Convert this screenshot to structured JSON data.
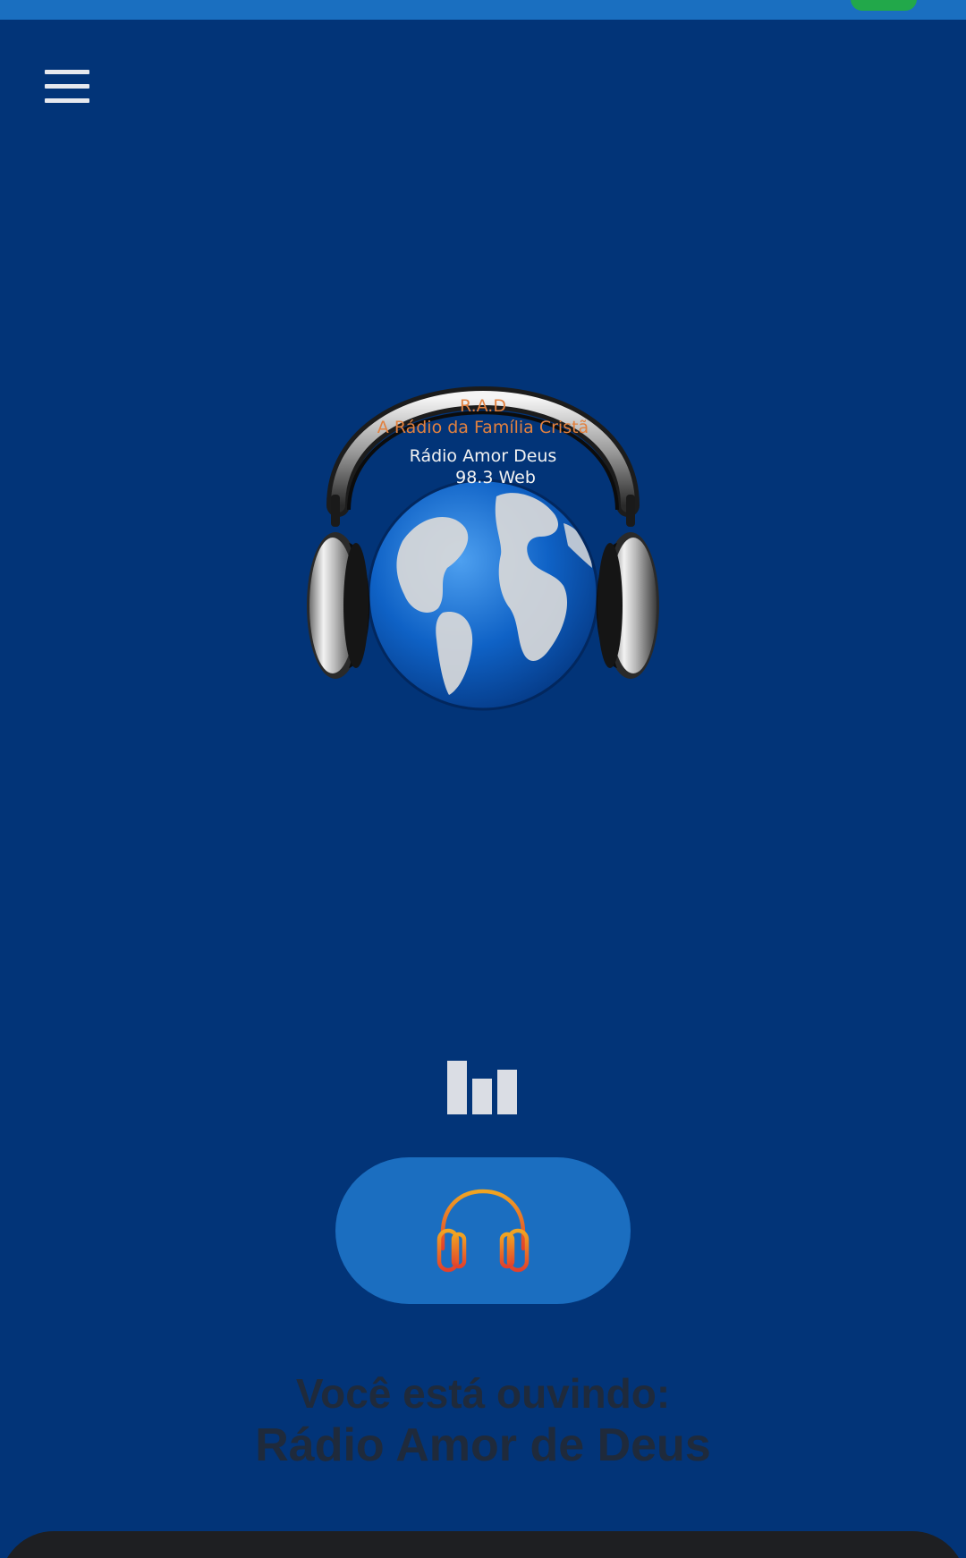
{
  "app": {
    "logo": {
      "line1": "R.A.D",
      "line2": "A Rádio da Família Cristã",
      "line3": "Rádio Amor Deus",
      "line4": "98.3 Web"
    },
    "icons": {
      "menu": "hamburger-menu-icon",
      "equalizer": "equalizer-icon",
      "play": "headphones-icon"
    },
    "now_playing": {
      "label": "Você está ouvindo:",
      "station": "Rádio Amor de Deus"
    },
    "colors": {
      "background": "#023478",
      "status_bar": "#1a6fc0",
      "button": "#1b6ec0",
      "logo_accent": "#e2813f",
      "headphone_gradient_start": "#f0a522",
      "headphone_gradient_end": "#e2412b",
      "text_dark": "#1f2a3b"
    }
  }
}
